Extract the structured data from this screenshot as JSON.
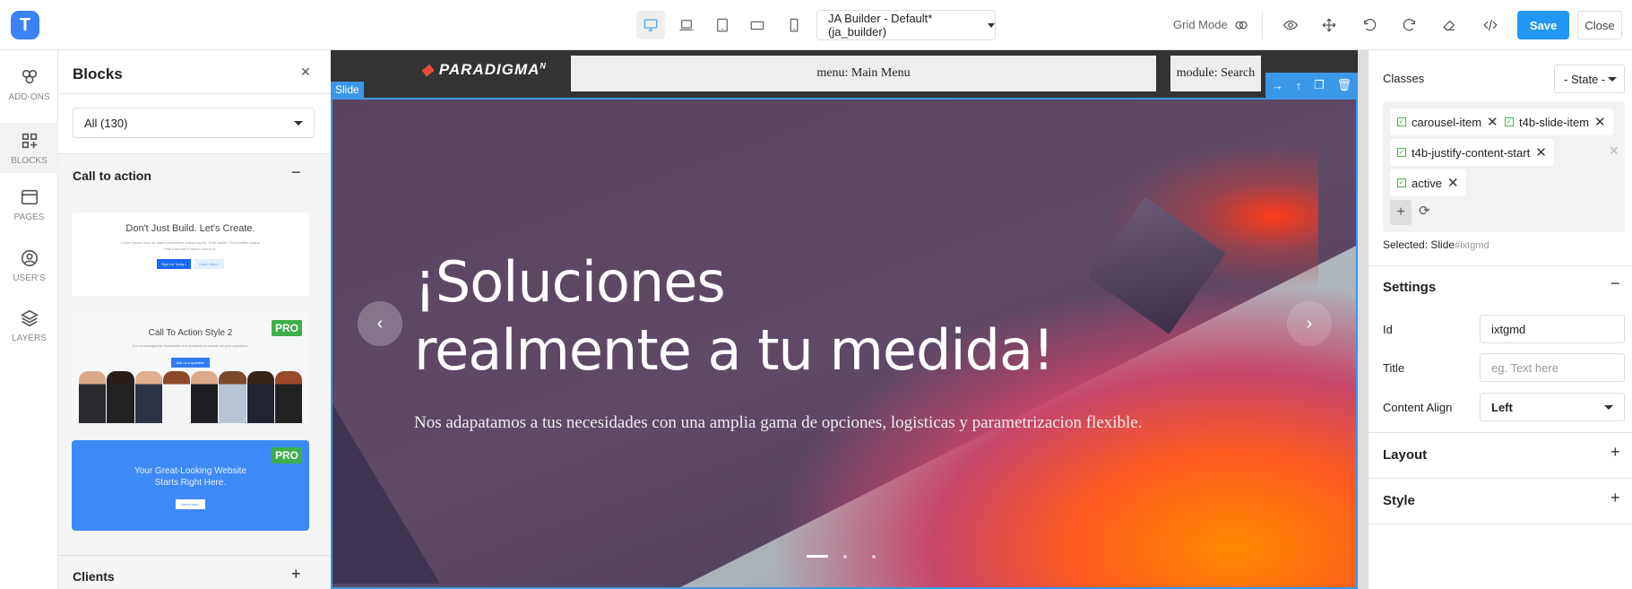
{
  "app": {
    "logo_letter": "T",
    "template_select": "JA Builder - Default* (ja_builder)",
    "grid_mode_label": "Grid Mode",
    "save_label": "Save",
    "close_label": "Close",
    "devices": [
      "desktop",
      "laptop",
      "tablet",
      "tablet-landscape",
      "mobile"
    ],
    "active_device": "desktop"
  },
  "rail": {
    "items": [
      {
        "label": "ADD-ONS",
        "icon": "hexagons-icon"
      },
      {
        "label": "BLOCKS",
        "icon": "blocks-icon",
        "active": true
      },
      {
        "label": "PAGES",
        "icon": "browser-window-icon"
      },
      {
        "label": "USER'S",
        "icon": "user-circle-icon"
      },
      {
        "label": "LAYERS",
        "icon": "layers-icon"
      }
    ]
  },
  "blocks": {
    "title": "Blocks",
    "filter": "All (130)",
    "section_open": "Call to action",
    "section_closed": "Clients",
    "cards": [
      {
        "title": "Don't Just Build. Let's Create.",
        "body": "Lorem ipsum dolor sit amet consectetur adipiscing elit. Nulla facilisi. Sed porttitor augue erat a hendrerit neque viverra et.",
        "btn1": "Sign Up Today ›",
        "btn2": "Learn More ›"
      },
      {
        "title": "Call To Action Style 2",
        "body": "Our knowledgeable Specialists are available to answer all your questions.",
        "btn1": "Ask us a question",
        "badge": "PRO"
      },
      {
        "title": "Your Great-Looking Website Starts Right Here.",
        "btn1": "Get it now! ›",
        "badge": "PRO"
      }
    ]
  },
  "canvas": {
    "site_logo": "PARADIGMA",
    "site_logo_sup": "N",
    "menu_placeholder": "menu: Main Menu",
    "module_placeholder": "module: Search",
    "selected_label": "Slide",
    "hero": {
      "line1": "¡Soluciones",
      "line2": "realmente a tu medida!",
      "subtitle": "Nos adapatamos a tus necesidades con una amplia gama de opciones, logisticas y parametrizacion flexible.",
      "slides": 3,
      "active_slide": 1
    }
  },
  "props": {
    "classes_label": "Classes",
    "state_select": "- State -",
    "classes": [
      "carousel-item",
      "t4b-slide-item",
      "t4b-justify-content-start",
      "active"
    ],
    "selected_label": "Selected:",
    "selected_name": "Slide",
    "selected_id": "#ixtgmd",
    "settings": {
      "title": "Settings",
      "id_label": "Id",
      "id_value": "ixtgmd",
      "title_label": "Title",
      "title_placeholder": "eg. Text here",
      "align_label": "Content Align",
      "align_value": "Left"
    },
    "layout_title": "Layout",
    "style_title": "Style"
  }
}
